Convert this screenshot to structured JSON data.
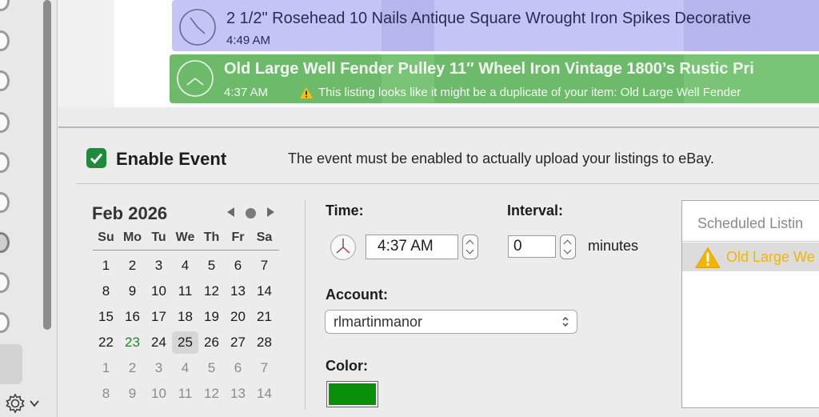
{
  "listings": [
    {
      "title": "2 1/2\" Rosehead 10 Nails Antique Square Wrought Iron Spikes Decorative",
      "time": "4:49 AM",
      "color": "#c4c4f6"
    },
    {
      "title": "Old Large Well Fender Pulley 11″ Wheel Iron Vintage 1800’s Rustic Pri",
      "time": "4:37 AM",
      "warning": "This listing looks like it might be a duplicate of your item: Old Large Well Fender",
      "color": "#6dbb6a"
    }
  ],
  "event": {
    "enable_label": "Enable Event",
    "enabled": true,
    "hint": "The event must be enabled to actually upload your listings to eBay."
  },
  "calendar": {
    "month_label": "Feb 2026",
    "weekdays": [
      "Su",
      "Mo",
      "Tu",
      "We",
      "Th",
      "Fr",
      "Sa"
    ],
    "weeks": [
      [
        "1",
        "2",
        "3",
        "4",
        "5",
        "6",
        "7"
      ],
      [
        "8",
        "9",
        "10",
        "11",
        "12",
        "13",
        "14"
      ],
      [
        "15",
        "16",
        "17",
        "18",
        "19",
        "20",
        "21"
      ],
      [
        "22",
        "23",
        "24",
        "25",
        "26",
        "27",
        "28"
      ],
      [
        "1",
        "2",
        "3",
        "4",
        "5",
        "6",
        "7"
      ],
      [
        "8",
        "9",
        "10",
        "11",
        "12",
        "13",
        "14"
      ]
    ],
    "today": "23",
    "selected": "25",
    "next_month_from_week": 4
  },
  "schedule": {
    "time_label": "Time:",
    "time_value": "4:37 AM",
    "interval_label": "Interval:",
    "interval_value": "0",
    "interval_unit": "minutes",
    "account_label": "Account:",
    "account_value": "rlmartinmanor",
    "color_label": "Color:",
    "color_value": "#0a8f0a"
  },
  "scheduled_panel": {
    "header": "Scheduled Listin",
    "items": [
      {
        "label": "Old Large We",
        "status": "warning"
      }
    ]
  },
  "icons": {
    "clock": "clock-icon",
    "warning": "warning-icon",
    "gear": "gear-icon",
    "check": "checkmark-icon"
  }
}
